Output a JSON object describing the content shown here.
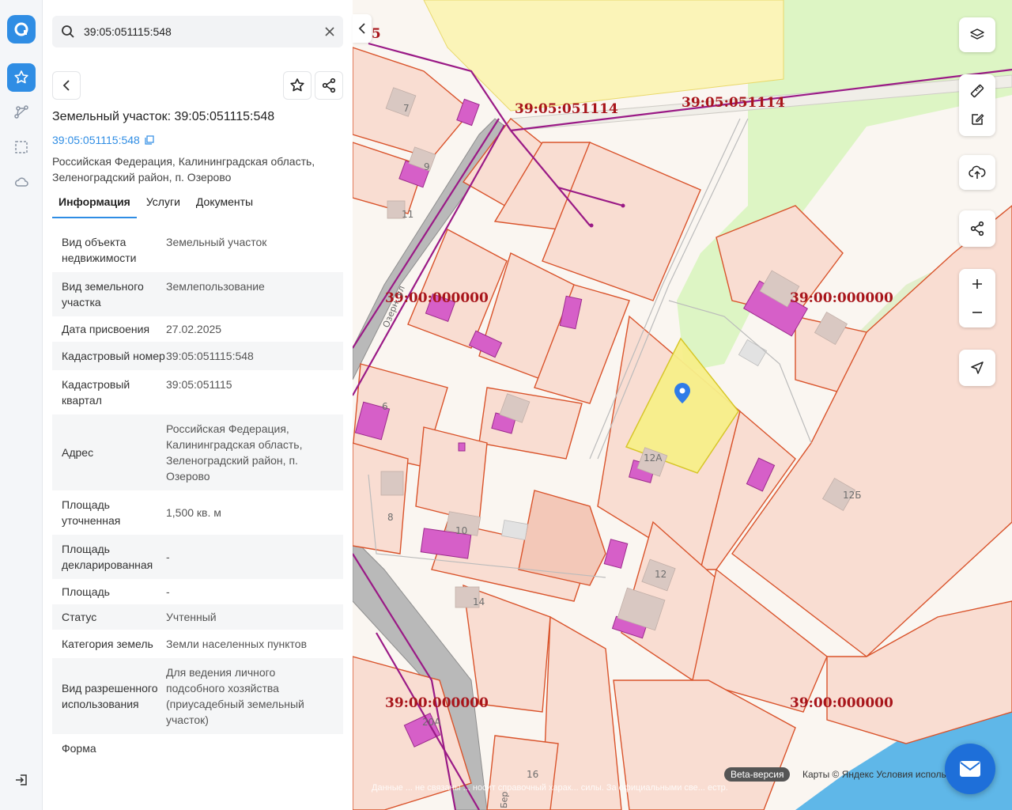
{
  "search": {
    "value": "39:05:051115:548"
  },
  "object": {
    "title": "Земельный участок: 39:05:051115:548",
    "cad_link": "39:05:051115:548",
    "address": "Российская Федерация, Калининградская область, Зеленоградский район, п. Озерово"
  },
  "tabs": [
    {
      "label": "Информация"
    },
    {
      "label": "Услуги"
    },
    {
      "label": "Документы"
    }
  ],
  "info_rows": [
    {
      "k": "Вид объекта недвижимости",
      "v": "Земельный участок"
    },
    {
      "k": "Вид земельного участка",
      "v": "Землепользование"
    },
    {
      "k": "Дата присвоения",
      "v": "27.02.2025"
    },
    {
      "k": "Кадастровый номер",
      "v": "39:05:051115:548"
    },
    {
      "k": "Кадастровый квартал",
      "v": "39:05:051115"
    },
    {
      "k": "Адрес",
      "v": "Российская Федерация, Калининградская область, Зеленоградский район, п. Озерово"
    },
    {
      "k": "Площадь уточненная",
      "v": "1,500 кв. м"
    },
    {
      "k": "Площадь декларированная",
      "v": "-"
    },
    {
      "k": "Площадь",
      "v": "-"
    },
    {
      "k": "Статус",
      "v": "Учтенный"
    },
    {
      "k": "Категория земель",
      "v": "Земли населенных пунктов"
    },
    {
      "k": "Вид разрешенного использования",
      "v": "Для ведения личного подсобного хозяйства (приусадебный земельный участок)"
    },
    {
      "k": "Форма",
      "v": ""
    }
  ],
  "map": {
    "labels": {
      "q1": "39:05:051114",
      "q2": "39:05:051114",
      "q3": "39:00:000000",
      "q4": "39:00:000000",
      "q5": "39:00:000000",
      "q6": "39:00:000000",
      "edge": ".5",
      "street": "Озерн. ул",
      "street2": "Бер"
    },
    "house_numbers": [
      "7",
      "9",
      "11",
      "6",
      "8",
      "10",
      "12А",
      "12",
      "12Б",
      "14",
      "16",
      "20А"
    ],
    "beta": "Beta-версия",
    "attribution": "Карты © Яндекс   Условия исполь",
    "disclaimer": "Данные ... не связаны ... носит справочный харак... силы. За официальными све... естр.",
    "colors": {
      "selected_fill": "#f7ef8a",
      "parcel_stroke": "#d9532b",
      "building": "#d65fc8",
      "quarter_label": "#a8151b",
      "water": "#5fb7e8",
      "green": "#ddf5c4",
      "accent": "#2f8de4"
    }
  }
}
